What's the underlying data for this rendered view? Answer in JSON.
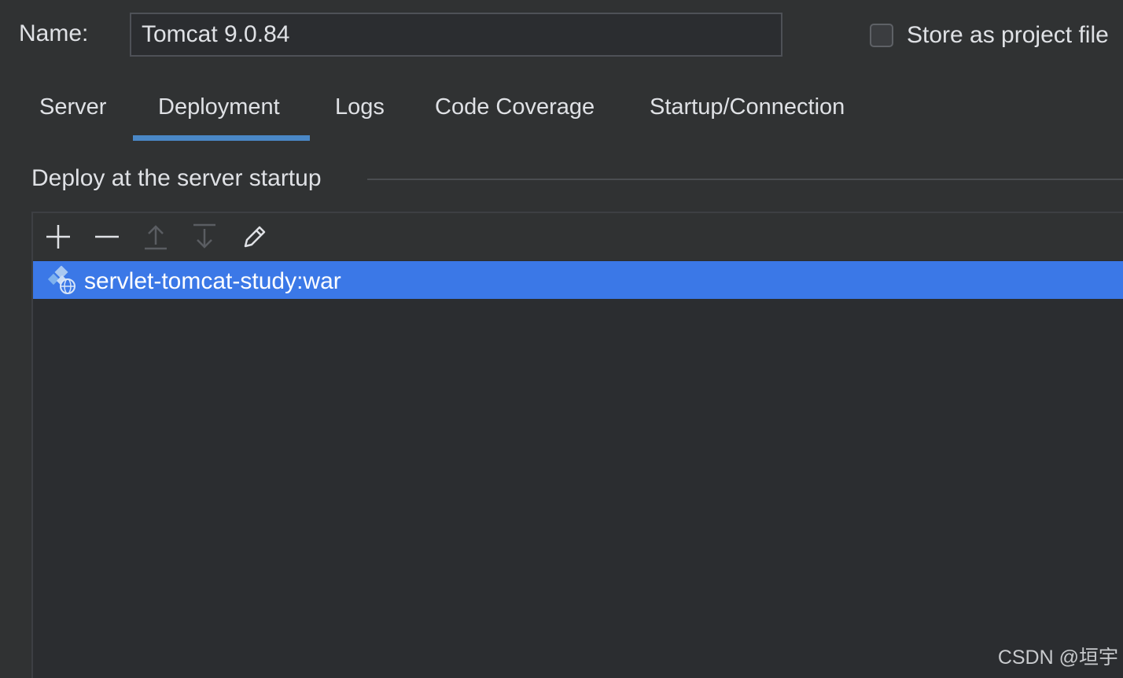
{
  "name_field": {
    "label": "Name:",
    "value": "Tomcat 9.0.84"
  },
  "store_option": {
    "label": "Store as project file",
    "checked": false
  },
  "tabs": [
    {
      "label": "Server",
      "selected": false
    },
    {
      "label": "Deployment",
      "selected": true
    },
    {
      "label": "Logs",
      "selected": false
    },
    {
      "label": "Code Coverage",
      "selected": false
    },
    {
      "label": "Startup/Connection",
      "selected": false
    }
  ],
  "deploy_section": {
    "title": "Deploy at the server startup",
    "toolbar": [
      {
        "icon": "plus-icon",
        "enabled": true
      },
      {
        "icon": "minus-icon",
        "enabled": true
      },
      {
        "icon": "move-up-icon",
        "enabled": false
      },
      {
        "icon": "move-down-icon",
        "enabled": false
      },
      {
        "icon": "edit-icon",
        "enabled": true
      }
    ],
    "items": [
      {
        "label": "servlet-tomcat-study:war",
        "icon": "web-artifact-icon",
        "selected": true
      }
    ]
  },
  "watermark": "CSDN @垣宇",
  "colors": {
    "background": "#303233",
    "selection": "#3b78e7",
    "tab_underline": "#4a88c7",
    "text": "#dfe1e5"
  }
}
